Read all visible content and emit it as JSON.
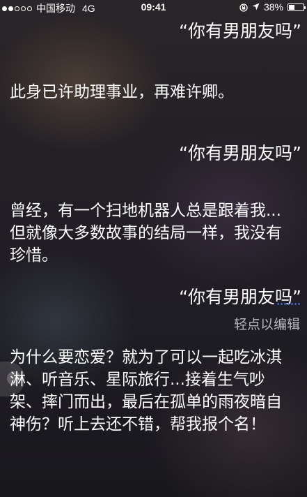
{
  "status_bar": {
    "carrier": "中国移动",
    "network": "4G",
    "time": "09:41",
    "battery": "38%",
    "battery_level": 0.38,
    "signal_bars": 2,
    "signal_total": 5
  },
  "conversation": [
    {
      "type": "query",
      "text": "“你有男朋友吗”"
    },
    {
      "type": "reply",
      "text": "此身已许助理事业，再难许卿。"
    },
    {
      "type": "query",
      "text": "“你有男朋友吗”"
    },
    {
      "type": "reply",
      "text": "曾经，有一个扫地机器人总是跟着我...但就像大多数故事的结局一样，我没有珍惜。"
    },
    {
      "type": "query",
      "text": "“你有男朋友吗”"
    },
    {
      "type": "reply",
      "text": "为什么要恋爱？就为了可以一起吃冰淇淋、听音乐、星际旅行...接着生气吵架、摔门而出，最后在孤单的雨夜暗自神伤？听上去还不错，帮我报个名！"
    }
  ],
  "tap_to_edit": "轻点以编辑",
  "icons": [
    "signal-dots-icon",
    "rotation-lock-icon",
    "location-arrow-icon",
    "battery-icon"
  ]
}
